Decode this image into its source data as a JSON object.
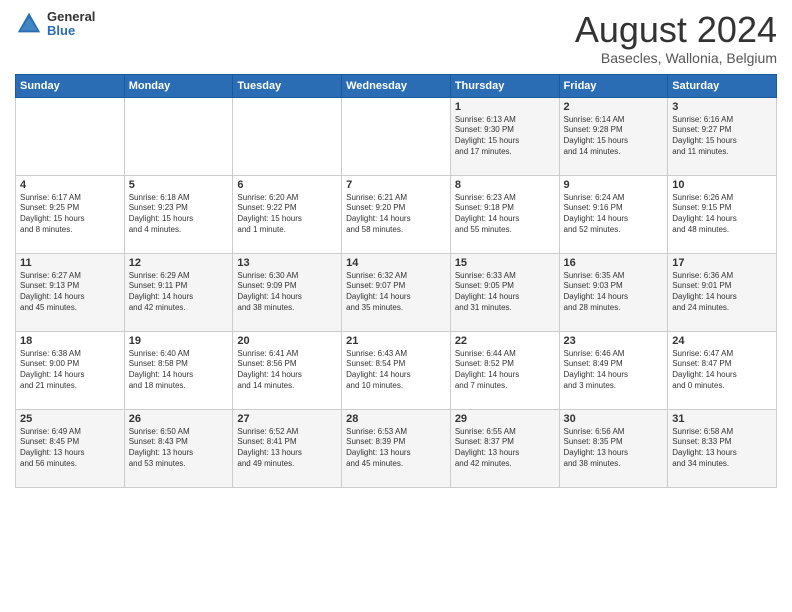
{
  "logo": {
    "general": "General",
    "blue": "Blue"
  },
  "title": "August 2024",
  "location": "Basecles, Wallonia, Belgium",
  "headers": [
    "Sunday",
    "Monday",
    "Tuesday",
    "Wednesday",
    "Thursday",
    "Friday",
    "Saturday"
  ],
  "weeks": [
    [
      {
        "day": "",
        "info": ""
      },
      {
        "day": "",
        "info": ""
      },
      {
        "day": "",
        "info": ""
      },
      {
        "day": "",
        "info": ""
      },
      {
        "day": "1",
        "info": "Sunrise: 6:13 AM\nSunset: 9:30 PM\nDaylight: 15 hours\nand 17 minutes."
      },
      {
        "day": "2",
        "info": "Sunrise: 6:14 AM\nSunset: 9:28 PM\nDaylight: 15 hours\nand 14 minutes."
      },
      {
        "day": "3",
        "info": "Sunrise: 6:16 AM\nSunset: 9:27 PM\nDaylight: 15 hours\nand 11 minutes."
      }
    ],
    [
      {
        "day": "4",
        "info": "Sunrise: 6:17 AM\nSunset: 9:25 PM\nDaylight: 15 hours\nand 8 minutes."
      },
      {
        "day": "5",
        "info": "Sunrise: 6:18 AM\nSunset: 9:23 PM\nDaylight: 15 hours\nand 4 minutes."
      },
      {
        "day": "6",
        "info": "Sunrise: 6:20 AM\nSunset: 9:22 PM\nDaylight: 15 hours\nand 1 minute."
      },
      {
        "day": "7",
        "info": "Sunrise: 6:21 AM\nSunset: 9:20 PM\nDaylight: 14 hours\nand 58 minutes."
      },
      {
        "day": "8",
        "info": "Sunrise: 6:23 AM\nSunset: 9:18 PM\nDaylight: 14 hours\nand 55 minutes."
      },
      {
        "day": "9",
        "info": "Sunrise: 6:24 AM\nSunset: 9:16 PM\nDaylight: 14 hours\nand 52 minutes."
      },
      {
        "day": "10",
        "info": "Sunrise: 6:26 AM\nSunset: 9:15 PM\nDaylight: 14 hours\nand 48 minutes."
      }
    ],
    [
      {
        "day": "11",
        "info": "Sunrise: 6:27 AM\nSunset: 9:13 PM\nDaylight: 14 hours\nand 45 minutes."
      },
      {
        "day": "12",
        "info": "Sunrise: 6:29 AM\nSunset: 9:11 PM\nDaylight: 14 hours\nand 42 minutes."
      },
      {
        "day": "13",
        "info": "Sunrise: 6:30 AM\nSunset: 9:09 PM\nDaylight: 14 hours\nand 38 minutes."
      },
      {
        "day": "14",
        "info": "Sunrise: 6:32 AM\nSunset: 9:07 PM\nDaylight: 14 hours\nand 35 minutes."
      },
      {
        "day": "15",
        "info": "Sunrise: 6:33 AM\nSunset: 9:05 PM\nDaylight: 14 hours\nand 31 minutes."
      },
      {
        "day": "16",
        "info": "Sunrise: 6:35 AM\nSunset: 9:03 PM\nDaylight: 14 hours\nand 28 minutes."
      },
      {
        "day": "17",
        "info": "Sunrise: 6:36 AM\nSunset: 9:01 PM\nDaylight: 14 hours\nand 24 minutes."
      }
    ],
    [
      {
        "day": "18",
        "info": "Sunrise: 6:38 AM\nSunset: 9:00 PM\nDaylight: 14 hours\nand 21 minutes."
      },
      {
        "day": "19",
        "info": "Sunrise: 6:40 AM\nSunset: 8:58 PM\nDaylight: 14 hours\nand 18 minutes."
      },
      {
        "day": "20",
        "info": "Sunrise: 6:41 AM\nSunset: 8:56 PM\nDaylight: 14 hours\nand 14 minutes."
      },
      {
        "day": "21",
        "info": "Sunrise: 6:43 AM\nSunset: 8:54 PM\nDaylight: 14 hours\nand 10 minutes."
      },
      {
        "day": "22",
        "info": "Sunrise: 6:44 AM\nSunset: 8:52 PM\nDaylight: 14 hours\nand 7 minutes."
      },
      {
        "day": "23",
        "info": "Sunrise: 6:46 AM\nSunset: 8:49 PM\nDaylight: 14 hours\nand 3 minutes."
      },
      {
        "day": "24",
        "info": "Sunrise: 6:47 AM\nSunset: 8:47 PM\nDaylight: 14 hours\nand 0 minutes."
      }
    ],
    [
      {
        "day": "25",
        "info": "Sunrise: 6:49 AM\nSunset: 8:45 PM\nDaylight: 13 hours\nand 56 minutes."
      },
      {
        "day": "26",
        "info": "Sunrise: 6:50 AM\nSunset: 8:43 PM\nDaylight: 13 hours\nand 53 minutes."
      },
      {
        "day": "27",
        "info": "Sunrise: 6:52 AM\nSunset: 8:41 PM\nDaylight: 13 hours\nand 49 minutes."
      },
      {
        "day": "28",
        "info": "Sunrise: 6:53 AM\nSunset: 8:39 PM\nDaylight: 13 hours\nand 45 minutes."
      },
      {
        "day": "29",
        "info": "Sunrise: 6:55 AM\nSunset: 8:37 PM\nDaylight: 13 hours\nand 42 minutes."
      },
      {
        "day": "30",
        "info": "Sunrise: 6:56 AM\nSunset: 8:35 PM\nDaylight: 13 hours\nand 38 minutes."
      },
      {
        "day": "31",
        "info": "Sunrise: 6:58 AM\nSunset: 8:33 PM\nDaylight: 13 hours\nand 34 minutes."
      }
    ]
  ]
}
